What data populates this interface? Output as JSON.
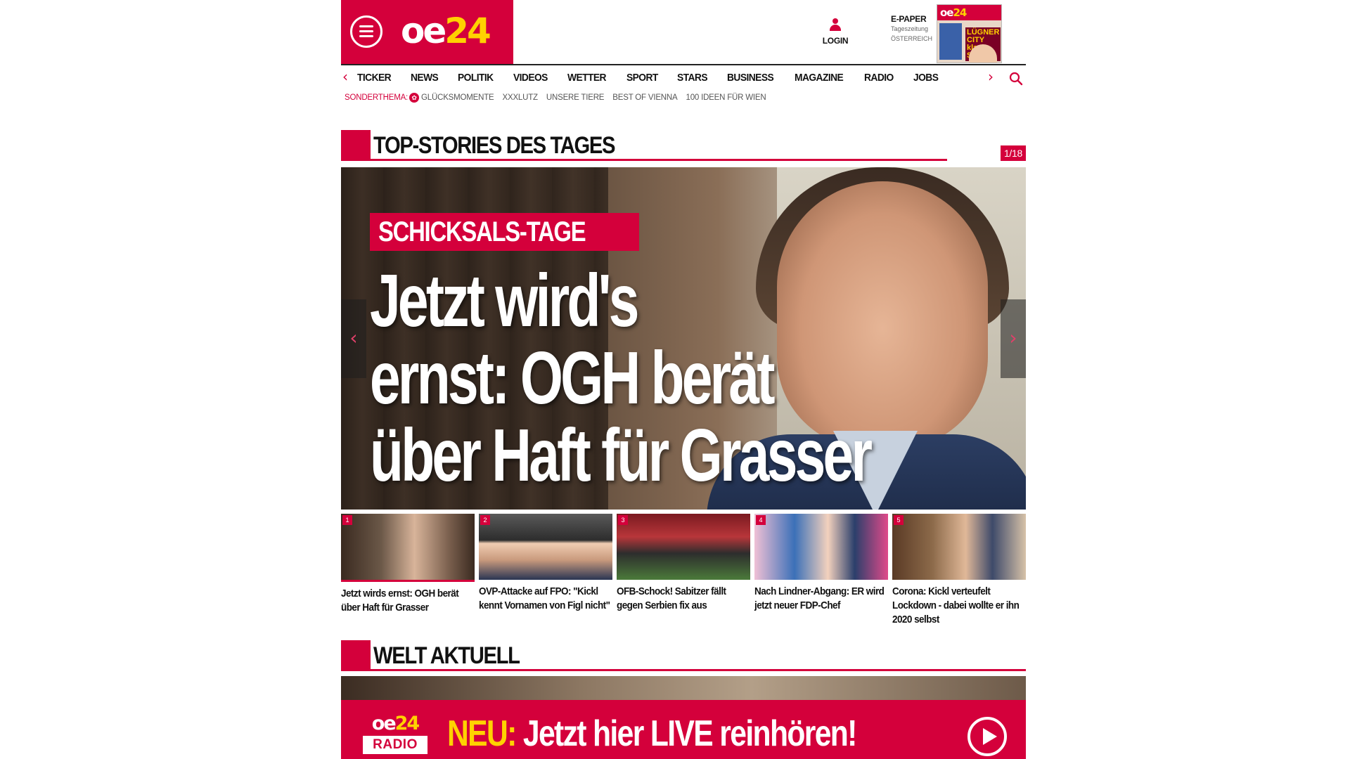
{
  "header": {
    "brand_oe": "oe",
    "brand_24": "24",
    "login_label": "LOGIN",
    "epaper": {
      "title": "E-PAPER",
      "sub1": "Tageszeitung",
      "sub2": "ÖSTERREICH",
      "cover_logo_oe": "oe",
      "cover_logo_24": "24",
      "cover_headline": "LÜGNER CITY klagt Simone"
    }
  },
  "nav": {
    "items": [
      "TICKER",
      "NEWS",
      "POLITIK",
      "VIDEOS",
      "WETTER",
      "SPORT",
      "STARS",
      "BUSINESS",
      "MAGAZINE",
      "RADIO",
      "JOBS"
    ]
  },
  "subnav": {
    "label": "SONDERTHEMA:",
    "badge": "✿",
    "links": [
      "GLÜCKSMOMENTE",
      "XXXLUTZ",
      "UNSERE TIERE",
      "BEST OF VIENNA",
      "100 IDEEN FÜR WIEN"
    ]
  },
  "top_stories": {
    "title": "TOP-STORIES DES TAGES",
    "counter": "1/18",
    "hero": {
      "kicker": "SCHICKSALS-TAGE",
      "title_line1": "Jetzt wird's",
      "title_line2": "ernst: OGH berät",
      "title_line3": "über Haft für Grasser"
    },
    "thumbs": [
      {
        "num": "1",
        "title": "Jetzt wirds ernst: OGH berät über Haft für Grasser"
      },
      {
        "num": "2",
        "title": "OVP-Attacke auf FPO: \"Kickl kennt Vornamen von Figl nicht\""
      },
      {
        "num": "3",
        "title": "OFB-Schock! Sabitzer fällt gegen Serbien fix aus"
      },
      {
        "num": "4",
        "title": "Nach Lindner-Abgang: ER wird jetzt neuer FDP-Chef"
      },
      {
        "num": "5",
        "title": "Corona: Kickl verteufelt Lockdown - dabei wollte er ihn 2020 selbst"
      }
    ]
  },
  "welt": {
    "title": "WELT AKTUELL"
  },
  "radio_banner": {
    "logo_oe": "oe",
    "logo_24": "24",
    "logo_tag": "RADIO",
    "neu": "NEU:",
    "text": " Jetzt hier LIVE reinhören!"
  },
  "colors": {
    "brand_red": "#d4003b",
    "brand_yellow": "#ffd200"
  }
}
